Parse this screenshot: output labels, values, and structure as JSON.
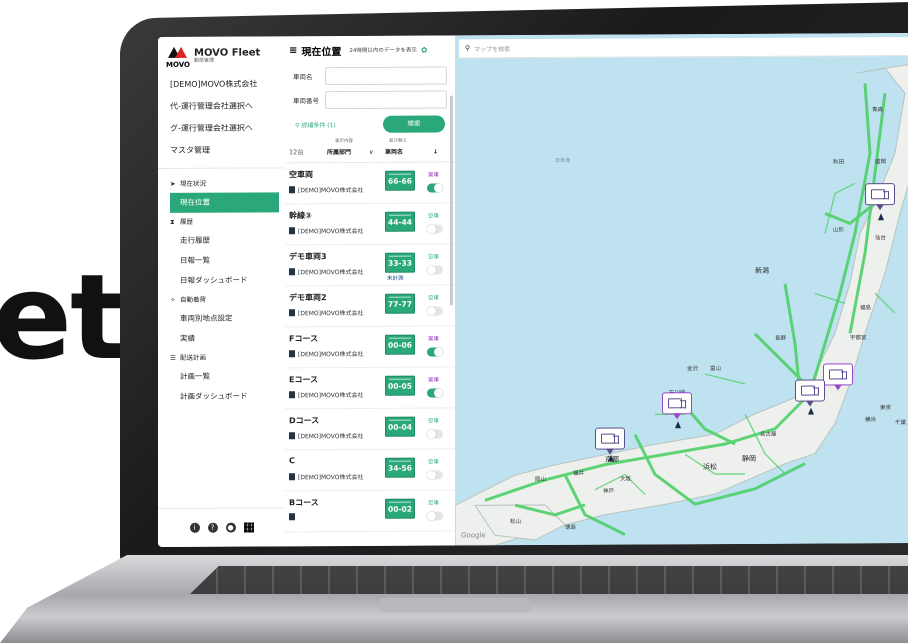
{
  "hero": {
    "word": "et"
  },
  "app": {
    "brand": "MOVO Fleet",
    "brand_sub": "動態管理",
    "logo_small": "MOVO"
  },
  "sidebar": {
    "company": "[DEMO]MOVO株式会社",
    "links": [
      "代-運行管理会社選択へ",
      "グ-運行管理会社選択へ",
      "マスタ管理"
    ],
    "sections": [
      {
        "title": "現在状況",
        "items": [
          "現在位置"
        ]
      },
      {
        "title": "履歴",
        "items": [
          "走行履歴",
          "日報一覧",
          "日報ダッシュボード"
        ]
      },
      {
        "title": "自動着荷",
        "items": [
          "車両別地点設定",
          "実績"
        ]
      },
      {
        "title": "配送計画",
        "items": [
          "計画一覧",
          "計画ダッシュボード"
        ]
      }
    ],
    "active_item": "現在位置",
    "footer_icons": [
      "info-icon",
      "help-icon",
      "user-icon",
      "apps-grid-icon"
    ]
  },
  "panel": {
    "title": "現在位置",
    "note": "24時間以内のデータを表示",
    "vehicle_name_label": "車両名",
    "vehicle_number_label": "車両番号",
    "vehicle_name_value": "",
    "vehicle_number_value": "",
    "advanced": "詳細条件 (1)",
    "search_button": "検索",
    "count": "12台",
    "display_label": "表示内容",
    "display_value": "所属部門",
    "sort_label": "並び替え",
    "sort_value": "車両名",
    "vehicles": [
      {
        "name": "空車両",
        "org": "[DEMO]MOVO株式会社",
        "plate": "66-66",
        "status": "実車",
        "live": true,
        "on": true,
        "note": ""
      },
      {
        "name": "幹線③",
        "org": "[DEMO]MOVO株式会社",
        "plate": "44-44",
        "status": "空車",
        "live": false,
        "on": false,
        "note": ""
      },
      {
        "name": "デモ車両3",
        "org": "[DEMO]MOVO株式会社",
        "plate": "33-33",
        "status": "空車",
        "live": false,
        "on": false,
        "note": "未計測"
      },
      {
        "name": "デモ車両2",
        "org": "[DEMO]MOVO株式会社",
        "plate": "77-77",
        "status": "空車",
        "live": false,
        "on": false,
        "note": ""
      },
      {
        "name": "Fコース",
        "org": "[DEMO]MOVO株式会社",
        "plate": "00-06",
        "status": "実車",
        "live": true,
        "on": true,
        "note": ""
      },
      {
        "name": "Eコース",
        "org": "[DEMO]MOVO株式会社",
        "plate": "00-05",
        "status": "実車",
        "live": true,
        "on": true,
        "note": ""
      },
      {
        "name": "Dコース",
        "org": "[DEMO]MOVO株式会社",
        "plate": "00-04",
        "status": "空車",
        "live": false,
        "on": false,
        "note": ""
      },
      {
        "name": "C",
        "org": "[DEMO]MOVO株式会社",
        "plate": "34-56",
        "status": "空車",
        "live": false,
        "on": false,
        "note": ""
      },
      {
        "name": "Bコース",
        "org": "",
        "plate": "00-02",
        "status": "空車",
        "live": false,
        "on": false,
        "note": ""
      }
    ]
  },
  "map": {
    "search_placeholder": "マップを検索",
    "sea_label": "日本海",
    "places": [
      "青森",
      "秋田",
      "盛岡",
      "山形",
      "仙台",
      "新潟",
      "福島",
      "宇都宮",
      "長野",
      "金沢",
      "石川県",
      "富山",
      "名古屋",
      "静岡",
      "浜松",
      "京都",
      "大阪",
      "神戸",
      "岡山",
      "松山",
      "徳島",
      "福井",
      "横浜",
      "千葉",
      "東京"
    ],
    "big_places": [
      "新潟",
      "京都",
      "静岡",
      "浜松"
    ],
    "attribution": "Google"
  }
}
